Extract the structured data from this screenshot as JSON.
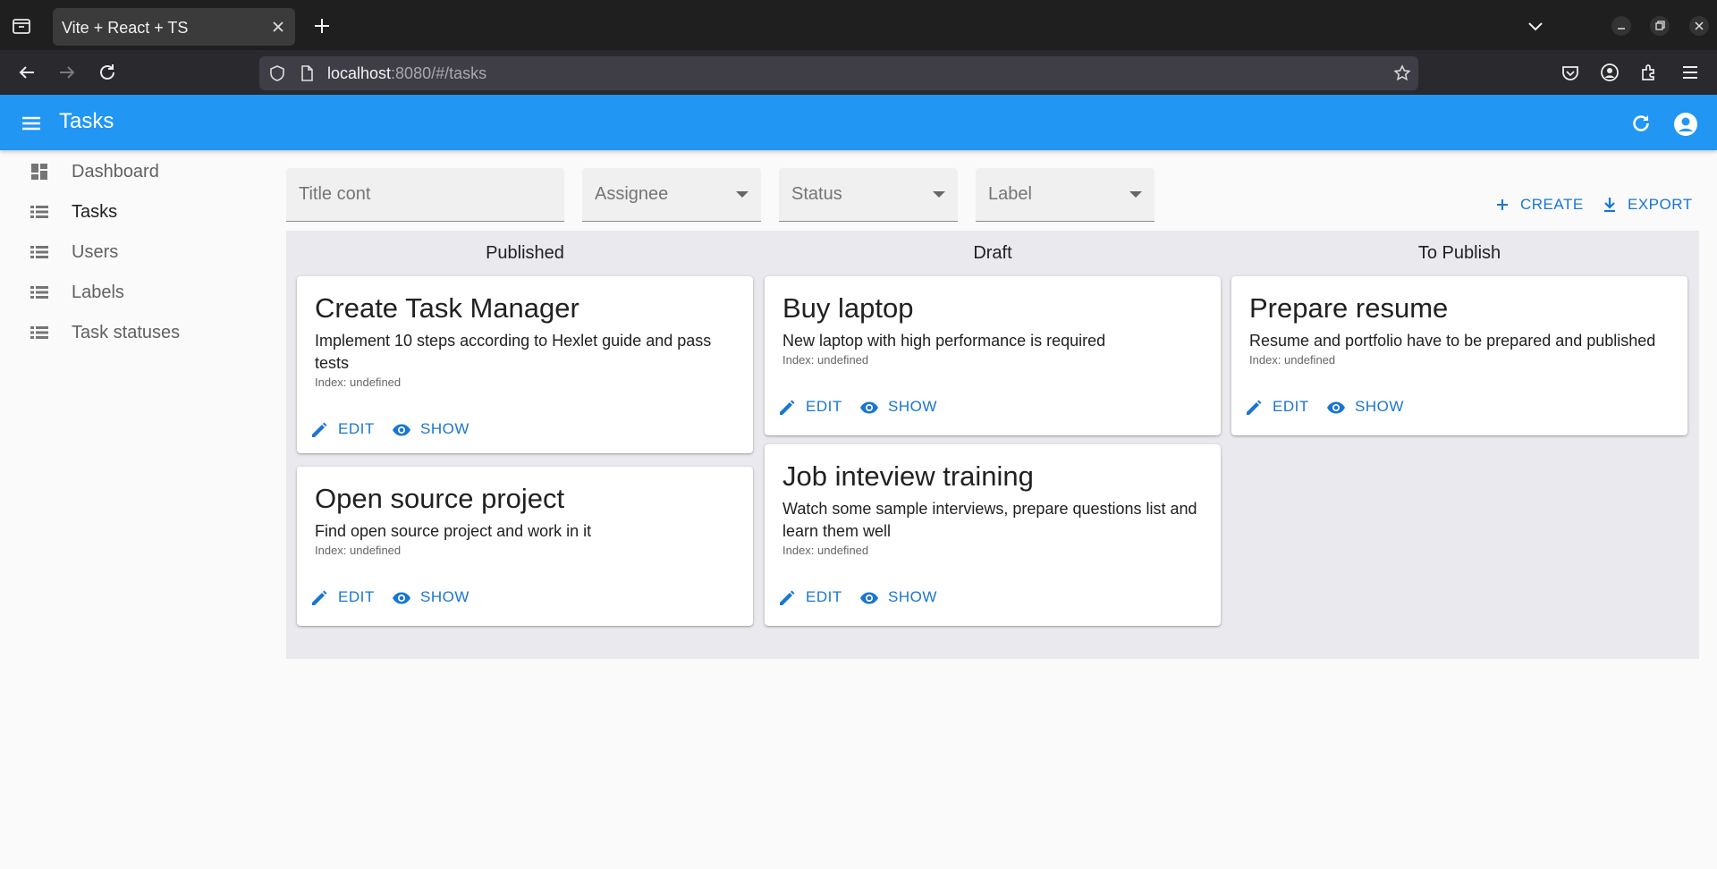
{
  "browser": {
    "tab_title": "Vite + React + TS",
    "url_host": "localhost",
    "url_rest": ":8080/#/tasks"
  },
  "app": {
    "title": "Tasks",
    "primary_color": "#2196f3",
    "accent_color": "#1976d2"
  },
  "sidebar": {
    "items": [
      {
        "label": "Dashboard",
        "icon": "dashboard-icon"
      },
      {
        "label": "Tasks",
        "icon": "list-icon",
        "active": true
      },
      {
        "label": "Users",
        "icon": "list-icon"
      },
      {
        "label": "Labels",
        "icon": "list-icon"
      },
      {
        "label": "Task statuses",
        "icon": "list-icon"
      }
    ]
  },
  "filters": {
    "title": "Title cont",
    "assignee": "Assignee",
    "status": "Status",
    "label": "Label"
  },
  "actions": {
    "create": "CREATE",
    "export": "EXPORT"
  },
  "board": {
    "columns": [
      {
        "title": "Published",
        "cards": [
          {
            "title": "Create Task Manager",
            "description": "Implement 10 steps according to Hexlet guide and pass tests",
            "index": "Index: undefined",
            "edit": "EDIT",
            "show": "SHOW"
          },
          {
            "title": "Open source project",
            "description": "Find open source project and work in it",
            "index": "Index: undefined",
            "edit": "EDIT",
            "show": "SHOW"
          }
        ]
      },
      {
        "title": "Draft",
        "cards": [
          {
            "title": "Buy laptop",
            "description": "New laptop with high performance is required",
            "index": "Index: undefined",
            "edit": "EDIT",
            "show": "SHOW"
          },
          {
            "title": "Job inteview training",
            "description": "Watch some sample interviews, prepare questions list and learn them well",
            "index": "Index: undefined",
            "edit": "EDIT",
            "show": "SHOW"
          }
        ]
      },
      {
        "title": "To Publish",
        "cards": [
          {
            "title": "Prepare resume",
            "description": "Resume and portfolio have to be prepared and published",
            "index": "Index: undefined",
            "edit": "EDIT",
            "show": "SHOW"
          }
        ]
      }
    ]
  }
}
